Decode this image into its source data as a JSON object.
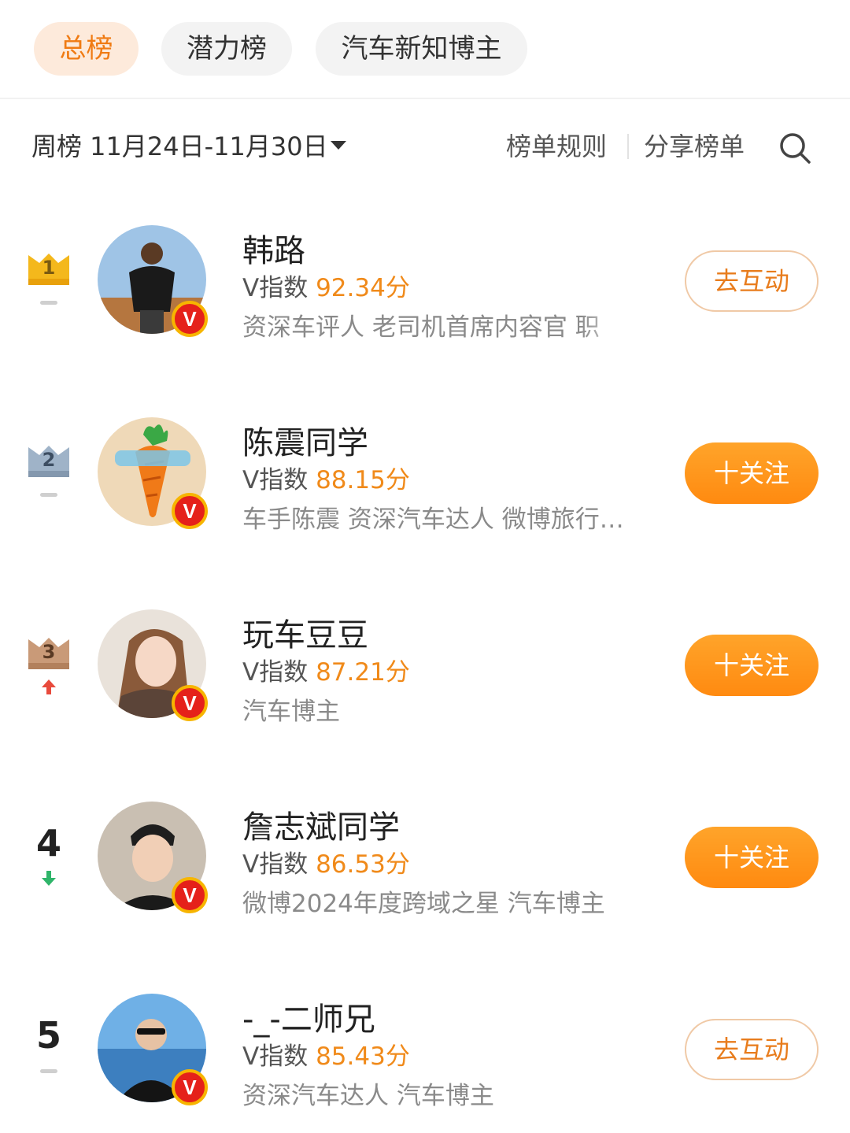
{
  "tabs": [
    "总榜",
    "潜力榜",
    "汽车新知博主"
  ],
  "filter": {
    "week_label": "周榜 11月24日-11月30日",
    "rules": "榜单规则",
    "share": "分享榜单"
  },
  "score_prefix": "V指数",
  "verified_badge": "V",
  "colors": {
    "accent": "#f08a1a",
    "gold_crown": "#f4b81c",
    "silver_crown": "#9fb3c8",
    "bronze_crown": "#c99a78",
    "badge_red": "#e5211a",
    "trend_up": "#e84a3c",
    "trend_down": "#2fb56a"
  },
  "rows": [
    {
      "rank": "1",
      "rank_style": "gold",
      "trend": "flat",
      "name": "韩路",
      "score": "92.34分",
      "desc": "资深车评人 老司机首席内容官 职",
      "button": "去互动",
      "button_style": "outline",
      "avatar_icon": "man-portrait-icon"
    },
    {
      "rank": "2",
      "rank_style": "silver",
      "trend": "flat",
      "name": "陈震同学",
      "score": "88.15分",
      "desc": "车手陈震 资深汽车达人 微博旅行…",
      "button": "十关注",
      "button_style": "fill",
      "avatar_icon": "carrot-icon"
    },
    {
      "rank": "3",
      "rank_style": "bronze",
      "trend": "up",
      "name": "玩车豆豆",
      "score": "87.21分",
      "desc": "汽车博主",
      "button": "十关注",
      "button_style": "fill",
      "avatar_icon": "woman-portrait-icon"
    },
    {
      "rank": "4",
      "rank_style": "plain",
      "trend": "down",
      "name": "詹志斌同学",
      "score": "86.53分",
      "desc": "微博2024年度跨域之星 汽车博主",
      "button": "十关注",
      "button_style": "fill",
      "avatar_icon": "man-portrait-icon"
    },
    {
      "rank": "5",
      "rank_style": "plain",
      "trend": "flat",
      "name": "-_-二师兄",
      "score": "85.43分",
      "desc": "资深汽车达人 汽车博主",
      "button": "去互动",
      "button_style": "outline",
      "avatar_icon": "man-portrait-icon"
    }
  ]
}
